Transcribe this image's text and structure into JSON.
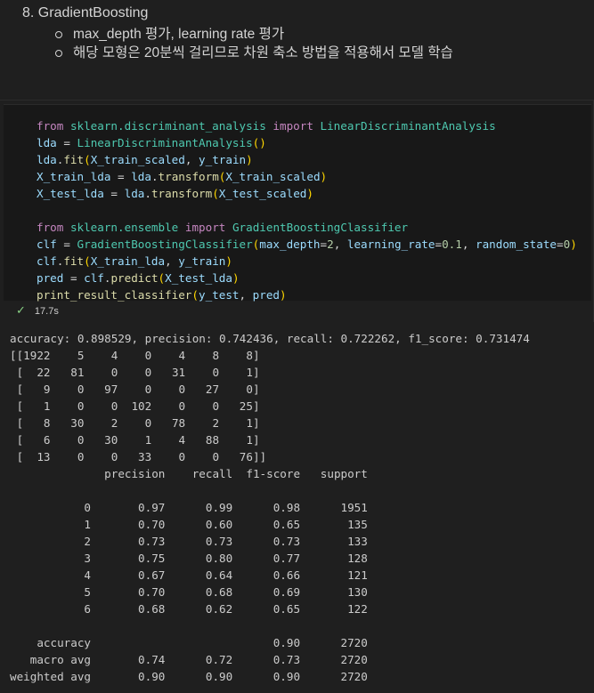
{
  "markdown": {
    "heading": "8. GradientBoosting",
    "bullets": [
      "max_depth 평가, learning rate 평가",
      "해당 모형은 20분씩 걸리므로 차원 축소 방법을 적용해서 모델 학습"
    ]
  },
  "code_cell": {
    "lines": [
      "from sklearn.discriminant_analysis import LinearDiscriminantAnalysis",
      "lda = LinearDiscriminantAnalysis()",
      "lda.fit(X_train_scaled, y_train)",
      "X_train_lda = lda.transform(X_train_scaled)",
      "X_test_lda = lda.transform(X_test_scaled)",
      "",
      "from sklearn.ensemble import GradientBoostingClassifier",
      "clf = GradientBoostingClassifier(max_depth=2, learning_rate=0.1, random_state=0)",
      "clf.fit(X_train_lda, y_train)",
      "pred = clf.predict(X_test_lda)",
      "print_result_classifier(y_test, pred)"
    ],
    "exec_time": "17.7s"
  },
  "output": {
    "lines": [
      "accuracy: 0.898529, precision: 0.742436, recall: 0.722262, f1_score: 0.731474",
      "[[1922    5    4    0    4    8    8]",
      " [  22   81    0    0   31    0    1]",
      " [   9    0   97    0    0   27    0]",
      " [   1    0    0  102    0    0   25]",
      " [   8   30    2    0   78    2    1]",
      " [   6    0   30    1    4   88    1]",
      " [  13    0    0   33    0    0   76]]",
      "              precision    recall  f1-score   support",
      "",
      "           0       0.97      0.99      0.98      1951",
      "           1       0.70      0.60      0.65       135",
      "           2       0.73      0.73      0.73       133",
      "           3       0.75      0.80      0.77       128",
      "           4       0.67      0.64      0.66       121",
      "           5       0.70      0.68      0.69       130",
      "           6       0.68      0.62      0.65       122",
      "",
      "    accuracy                           0.90      2720",
      "   macro avg       0.74      0.72      0.73      2720",
      "weighted avg       0.90      0.90      0.90      2720"
    ]
  }
}
